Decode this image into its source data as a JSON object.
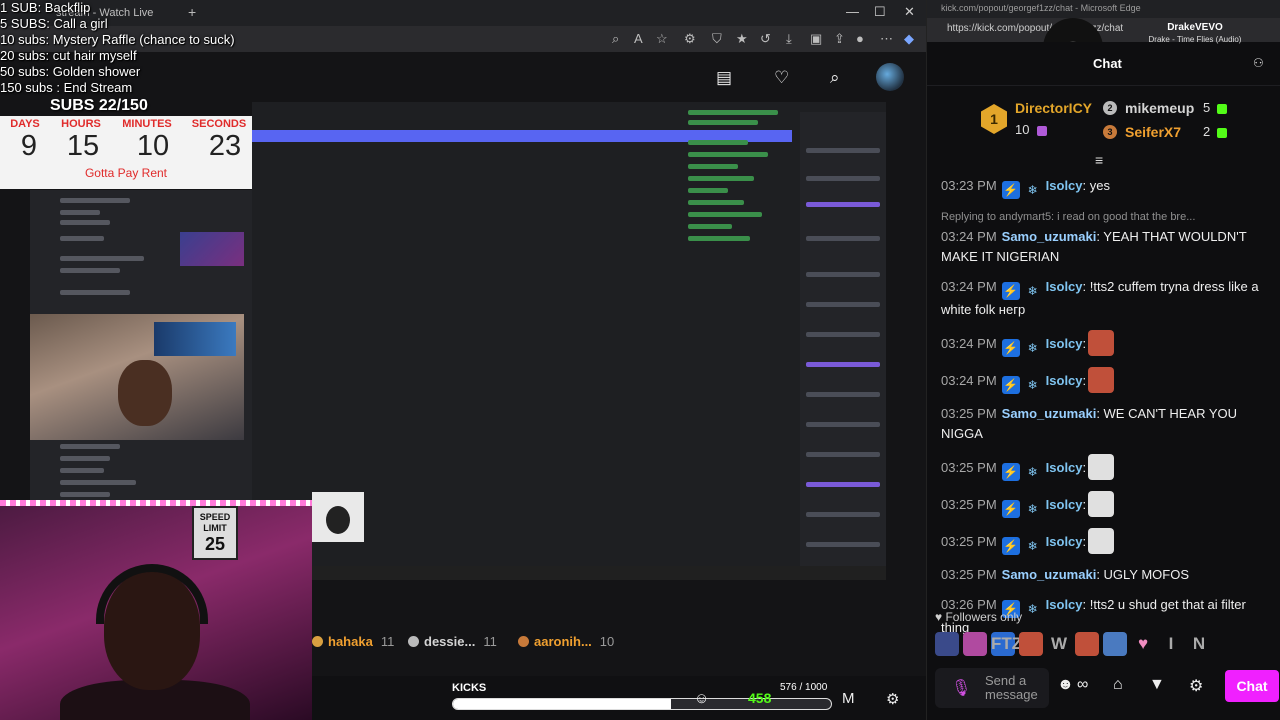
{
  "browser": {
    "tab_title": "stream - Watch Live",
    "window_controls": [
      "—",
      "☐",
      "✕"
    ]
  },
  "overlay": {
    "sub_goals": [
      "1 SUB: Backflip",
      "5 SUBS: Call a girl",
      "10 subs: Mystery Raffle (chance to suck)",
      "20 subs: cut hair myself",
      "50 subs: Golden shower",
      "150 subs : End Stream"
    ],
    "subs_count": "SUBS 22/150",
    "timer": {
      "labels": [
        "DAYS",
        "HOURS",
        "MINUTES",
        "SECONDS"
      ],
      "values": [
        "9",
        "15",
        "10",
        "23"
      ],
      "note": "Gotta Pay Rent"
    },
    "speed_sign": {
      "line1": "SPEED",
      "line2": "LIMIT",
      "value": "25"
    }
  },
  "leaderboard": [
    {
      "name": "hahaka",
      "count": "11",
      "color": "#f0a030"
    },
    {
      "name": "dessie...",
      "count": "11",
      "color": "#d4d4d4"
    },
    {
      "name": "aaronih...",
      "count": "10",
      "color": "#f0a030"
    }
  ],
  "kicks": {
    "label": "KICKS",
    "count": "576 / 1000",
    "progress": 0.576,
    "green_value": "458"
  },
  "chat_window": {
    "title": "kick.com/popout/georgef1zz/chat - Microsoft Edge",
    "url": "https://kick.com/popout/georgef1zz/chat",
    "now_playing_artist": "DrakeVEVO",
    "now_playing_song": "Drake - Time Flies (Audio)",
    "header_title": "Chat"
  },
  "gifters": [
    {
      "rank": "1",
      "name": "DirectorICY",
      "count": "10",
      "color": "#e3a62a"
    },
    {
      "rank": "2",
      "name": "mikemeup",
      "count": "5",
      "color": "#d4d4d4"
    },
    {
      "rank": "3",
      "name": "SeiferX7",
      "count": "2",
      "color": "#f0a030"
    }
  ],
  "messages": [
    {
      "time": "03:23 PM",
      "user": "Isolcy",
      "color": "#7fc4f0",
      "badges": true,
      "text": ": yes",
      "emotes": 0
    },
    {
      "reply": "Replying to andymart5: i read on good that the bre...",
      "time": "03:24 PM",
      "user": "Samo_uzumaki",
      "color": "#9ad0ff",
      "badges": false,
      "text": ": YEAH THAT WOULDN'T MAKE IT NIGERIAN",
      "emotes": 0
    },
    {
      "time": "03:24 PM",
      "user": "Isolcy",
      "color": "#7fc4f0",
      "badges": true,
      "text": ": !tts2 cuffem tryna dress like a white folk негр",
      "emotes": 0
    },
    {
      "time": "03:24 PM",
      "user": "Isolcy",
      "color": "#7fc4f0",
      "badges": true,
      "text": ":",
      "emotes": 1,
      "emote_color": "#c0503a"
    },
    {
      "time": "03:24 PM",
      "user": "Isolcy",
      "color": "#7fc4f0",
      "badges": true,
      "text": ":",
      "emotes": 1,
      "emote_color": "#c0503a"
    },
    {
      "time": "03:25 PM",
      "user": "Samo_uzumaki",
      "color": "#9ad0ff",
      "badges": false,
      "text": ": WE CAN'T HEAR YOU NIGGA",
      "emotes": 0
    },
    {
      "time": "03:25 PM",
      "user": "Isolcy",
      "color": "#7fc4f0",
      "badges": true,
      "text": ":",
      "emotes": 1,
      "emote_color": "#e0e0e0"
    },
    {
      "time": "03:25 PM",
      "user": "Isolcy",
      "color": "#7fc4f0",
      "badges": true,
      "text": ":",
      "emotes": 1,
      "emote_color": "#e0e0e0"
    },
    {
      "time": "03:25 PM",
      "user": "Isolcy",
      "color": "#7fc4f0",
      "badges": true,
      "text": ":",
      "emotes": 1,
      "emote_color": "#e0e0e0"
    },
    {
      "time": "03:25 PM",
      "user": "Samo_uzumaki",
      "color": "#9ad0ff",
      "badges": false,
      "text": ": UGLY MOFOS",
      "emotes": 0
    },
    {
      "time": "03:26 PM",
      "user": "Isolcy",
      "color": "#7fc4f0",
      "badges": true,
      "text": ": !tts2 u shud get that ai filter thing",
      "emotes": 0
    }
  ],
  "followers_only": "Followers only",
  "emote_bar": [
    "",
    "",
    "FTZ",
    "",
    "W",
    "",
    "",
    "♥",
    "I",
    "N"
  ],
  "input": {
    "placeholder": "Send a message",
    "send_label": "Chat"
  },
  "colors": {
    "kick_green": "#53fc18",
    "chat_button": "#f020ff",
    "timer_red": "#e02b2b"
  }
}
